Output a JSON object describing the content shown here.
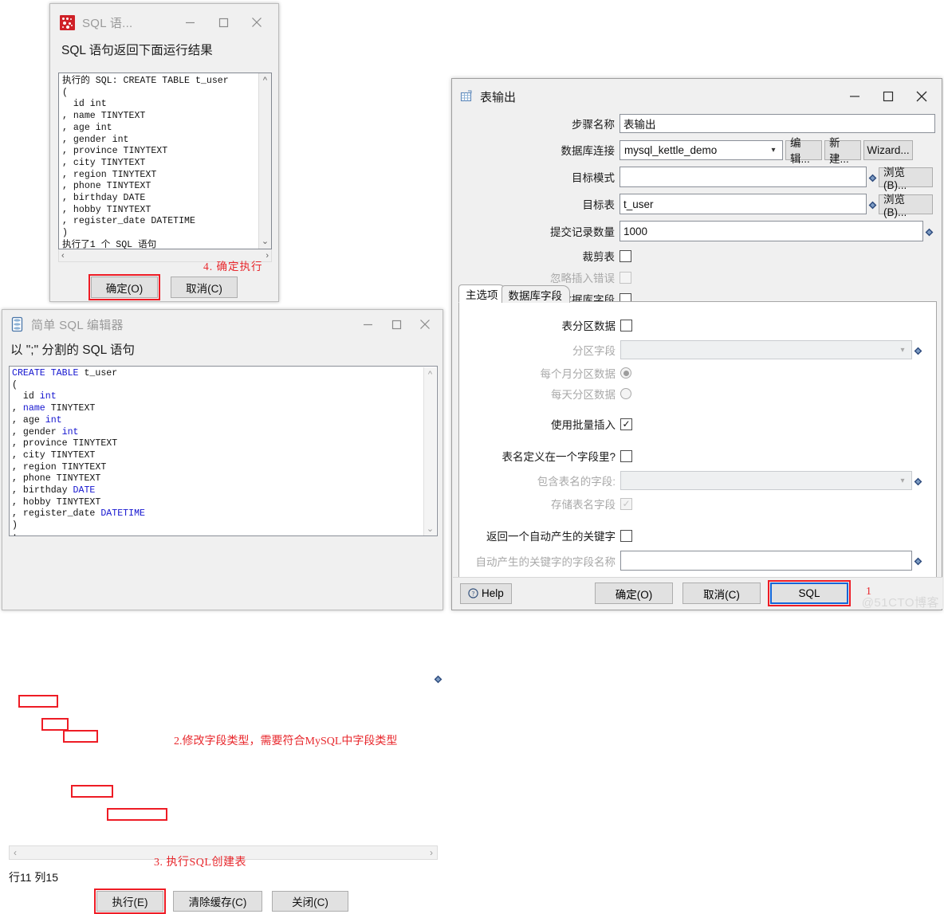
{
  "sql_result_window": {
    "title": "SQL 语...",
    "icon": "kettle-red-icon",
    "heading": "SQL 语句返回下面运行结果",
    "result_text": "执行的 SQL: CREATE TABLE t_user\n(\n  id int\n, name TINYTEXT\n, age int\n, gender int\n, province TINYTEXT\n, city TINYTEXT\n, region TINYTEXT\n, phone TINYTEXT\n, birthday DATE\n, hobby TINYTEXT\n, register_date DATETIME\n)\n执行了1 个 SQL 语句",
    "annotation": "4. 确定执行",
    "ok_label": "确定(O)",
    "cancel_label": "取消(C)",
    "minimize": "−",
    "maximize": "□",
    "close": "✕"
  },
  "sql_editor_window": {
    "title": "简单 SQL 编辑器",
    "icon": "database-icon",
    "heading": "以 \";\" 分割的 SQL 语句",
    "lines": [
      {
        "text": "CREATE TABLE t_user",
        "kw_end": 12
      },
      {
        "text": "("
      },
      {
        "text": "  id int"
      },
      {
        "text": ", name TINYTEXT"
      },
      {
        "text": ", age int"
      },
      {
        "text": ", gender int"
      },
      {
        "text": ", province TINYTEXT"
      },
      {
        "text": ", city TINYTEXT"
      },
      {
        "text": ", region TINYTEXT"
      },
      {
        "text": ", phone TINYTEXT"
      },
      {
        "text": ", birthday DATE"
      },
      {
        "text": ", hobby TINYTEXT"
      },
      {
        "text": ", register_date DATETIME"
      },
      {
        "text": ")"
      },
      {
        "text": ";"
      }
    ],
    "annotation": "2.修改字段类型，需要符合MySQL中字段类型",
    "annotation_exec": "3. 执行SQL创建表",
    "caret_status": "行11 列15",
    "execute_label": "执行(E)",
    "clear_cache_label": "清除缓存(C)",
    "close_label": "关闭(C)"
  },
  "table_output_window": {
    "title": "表输出",
    "icon": "table-grid-icon",
    "fields": {
      "step_name_label": "步骤名称",
      "step_name_value": "表输出",
      "db_conn_label": "数据库连接",
      "db_conn_value": "mysql_kettle_demo",
      "edit_btn": "编辑...",
      "new_btn": "新建...",
      "wizard_btn": "Wizard...",
      "target_schema_label": "目标模式",
      "target_schema_value": "",
      "browse_btn_1": "浏览(B)...",
      "target_table_label": "目标表",
      "target_table_value": "t_user",
      "browse_btn_2": "浏览(B)...",
      "commit_size_label": "提交记录数量",
      "commit_size_value": "1000",
      "truncate_label": "裁剪表",
      "ignore_insert_errors_label": "忽略插入错误",
      "specify_db_fields_label": "指定数据库字段"
    },
    "tabs": [
      {
        "label": "主选项",
        "active": true
      },
      {
        "label": "数据库字段",
        "active": false
      }
    ],
    "main_options": {
      "partition_data_label": "表分区数据",
      "partition_field_label": "分区字段",
      "partition_field_value": "",
      "partition_monthly_label": "每个月分区数据",
      "partition_daily_label": "每天分区数据",
      "use_batch_insert_label": "使用批量插入",
      "table_name_in_field_label": "表名定义在一个字段里?",
      "field_with_table_name_label": "包含表名的字段:",
      "field_with_table_name_value": "",
      "store_table_name_field_label": "存储表名字段",
      "return_autogen_key_label": "返回一个自动产生的关键字",
      "autogen_key_field_label": "自动产生的关键字的字段名称",
      "autogen_key_field_value": ""
    },
    "footer": {
      "help_label": "Help",
      "ok_label": "确定(O)",
      "cancel_label": "取消(C)",
      "sql_label": "SQL",
      "step_mark": "1"
    }
  },
  "watermark": "@51CTO博客",
  "colors": {
    "annotation_red": "#e8282d",
    "highlight_red": "#ee1c25",
    "sql_keyword_blue": "#1414cf",
    "focus_blue": "#1565d8",
    "title_gray": "#9a9a9a"
  }
}
